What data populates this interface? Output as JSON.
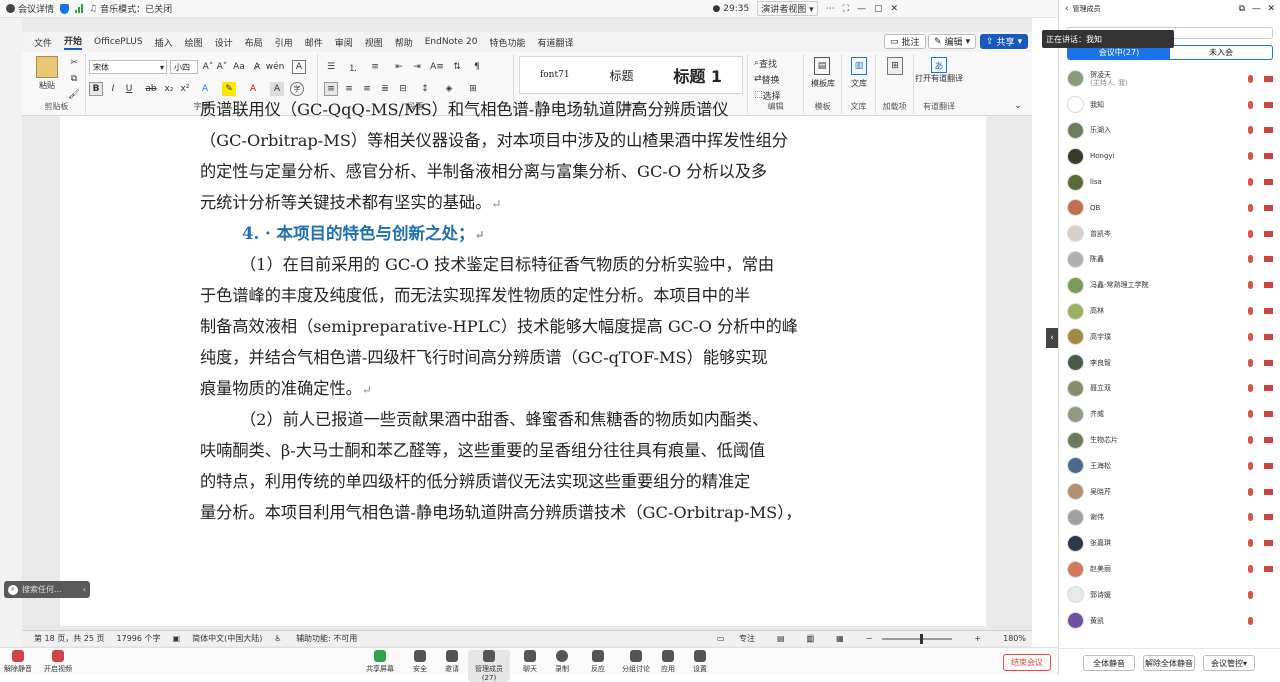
{
  "meeting_top": {
    "details": "会议详情",
    "music_mode": "音乐模式：已关闭",
    "timer": "29:35",
    "view": "演讲者视图"
  },
  "word": {
    "menu": [
      "文件",
      "开始",
      "OfficePLUS",
      "插入",
      "绘图",
      "设计",
      "布局",
      "引用",
      "邮件",
      "审阅",
      "视图",
      "帮助",
      "EndNote 20",
      "特色功能",
      "有道翻译"
    ],
    "active_menu": "开始",
    "comment_btn": "批注",
    "edit_btn": "编辑",
    "share_btn": "共享",
    "font_name": "宋体",
    "font_size": "小四",
    "groups": {
      "clipboard": "剪贴板",
      "paste": "粘贴",
      "font": "字体",
      "paragraph": "段落",
      "styles": "样式",
      "editing": "编辑",
      "template": "模板",
      "template_lib": "模板库",
      "docs": "文库",
      "doc_btn": "文库",
      "addins": "加载项",
      "translate": "有道翻译",
      "open_translate": "打开有道翻译"
    },
    "style_items": [
      "font71",
      "标题",
      "标题 1"
    ],
    "edit_items": {
      "find": "查找",
      "replace": "替换",
      "select": "选择"
    },
    "document": {
      "lines": [
        "质谱联用仪（GC-QqQ-MS/MS）和气相色谱-静电场轨道阱高分辨质谱仪",
        "（GC-Orbitrap-MS）等相关仪器设备，对本项目中涉及的山楂果酒中挥发性组分",
        "的定性与定量分析、感官分析、半制备液相分离与富集分析、GC-O 分析以及多",
        "元统计分析等关键技术都有坚实的基础。"
      ],
      "heading": "4. · 本项目的特色与创新之处；",
      "para1": [
        "（1）在目前采用的 GC-O 技术鉴定目标特征香气物质的分析实验中，常由",
        "于色谱峰的丰度及纯度低，而无法实现挥发性物质的定性分析。本项目中的半",
        "制备高效液相（semipreparative-HPLC）技术能够大幅度提高 GC-O 分析中的峰",
        "纯度，并结合气相色谱-四级杆飞行时间高分辨质谱（GC-qTOF-MS）能够实现",
        "痕量物质的准确定性。"
      ],
      "para2": [
        "（2）前人已报道一些贡献果酒中甜香、蜂蜜香和焦糖香的物质如内酯类、",
        "呋喃酮类、β-大马士酮和苯乙醛等，这些重要的呈香组分往往具有痕量、低阈值",
        "的特点，利用传统的单四级杆的低分辨质谱仪无法实现这些重要组分的精准定",
        "量分析。本项目利用气相色谱-静电场轨道阱高分辨质谱技术（GC-Orbitrap-MS），"
      ],
      "para_mark": "↵"
    },
    "status": {
      "page": "第 18 页，共 25 页",
      "words": "17996 个字",
      "lang": "简体中文(中国大陆)",
      "access": "辅助功能: 不可用",
      "focus": "专注",
      "zoom": "180%"
    }
  },
  "search_pill": "搜索任何...",
  "toolbar": {
    "mute": "解除静音",
    "video": "开启视频",
    "items": [
      "共享屏幕",
      "安全",
      "邀请",
      "管理成员(27)",
      "聊天",
      "录制",
      "反应",
      "分组讨论",
      "应用",
      "设置"
    ],
    "end": "结束会议"
  },
  "panel": {
    "title": "管理成员",
    "speaking": "正在讲话：我知",
    "tab_in": "会议中(27)",
    "tab_out": "未入会",
    "members": [
      {
        "name": "贺凌天",
        "sub": "(主持人, 我)",
        "color": "#8a9a7a"
      },
      {
        "name": "我知",
        "sub": "",
        "color": "#fff"
      },
      {
        "name": "乐湖入",
        "sub": "",
        "color": "#6b7b5b"
      },
      {
        "name": "Hongyi",
        "sub": "",
        "color": "#3a3a2a"
      },
      {
        "name": "lisa",
        "sub": "",
        "color": "#5a6a3a"
      },
      {
        "name": "QB",
        "sub": "",
        "color": "#c07050"
      },
      {
        "name": "曾凯岑",
        "sub": "",
        "color": "#d8d0c8"
      },
      {
        "name": "陈鑫",
        "sub": "",
        "color": "#b0b0b0"
      },
      {
        "name": "冯鑫-常熟理工学院",
        "sub": "",
        "color": "#7a9a5a"
      },
      {
        "name": "高林",
        "sub": "",
        "color": "#9ab05a"
      },
      {
        "name": "高宇璞",
        "sub": "",
        "color": "#a08a40"
      },
      {
        "name": "李良智",
        "sub": "",
        "color": "#4a5a4a"
      },
      {
        "name": "聂立双",
        "sub": "",
        "color": "#8a8a70"
      },
      {
        "name": "齐威",
        "sub": "",
        "color": "#909a80"
      },
      {
        "name": "生物芯片",
        "sub": "",
        "color": "#6a7a5a"
      },
      {
        "name": "王海松",
        "sub": "",
        "color": "#4a6a8a"
      },
      {
        "name": "吴晓芹",
        "sub": "",
        "color": "#b09070"
      },
      {
        "name": "谢伟",
        "sub": "",
        "color": "#a0a0a0"
      },
      {
        "name": "张嘉琪",
        "sub": "",
        "color": "#2a3a4a"
      },
      {
        "name": "赵美丽",
        "sub": "",
        "color": "#d07860"
      },
      {
        "name": "郭诗媛",
        "sub": "",
        "color": "#e8e8e8"
      },
      {
        "name": "黄凯",
        "sub": "",
        "color": "#7050a0"
      }
    ],
    "mute_all": "全体静音",
    "unmute_all": "解除全体静音",
    "control": "会议管控"
  },
  "colors": {
    "accent": "#1a73e8",
    "word_blue": "#185abd",
    "heading": "#1f6fb2",
    "end": "#e14b4b"
  }
}
